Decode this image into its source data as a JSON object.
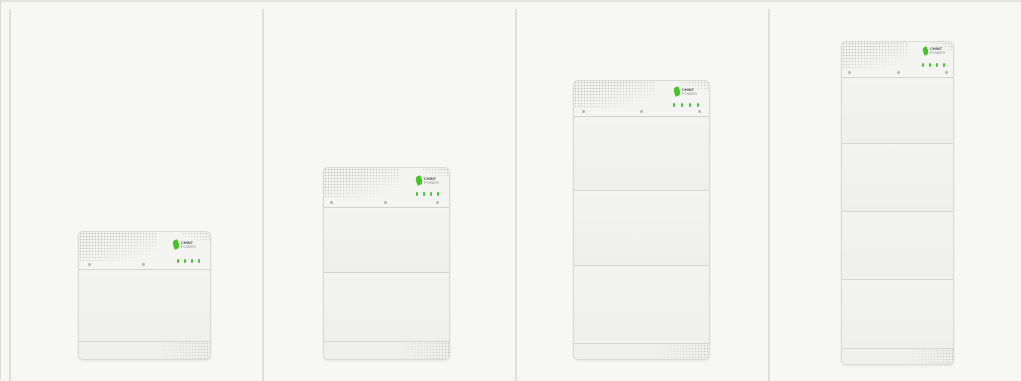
{
  "brand": {
    "line1": "CHINT",
    "line2": "POWER",
    "leaf_color": "#43c61d",
    "led_color": "#49c638"
  },
  "products": [
    {
      "name": "battery-1-module",
      "modules": 1,
      "leds": 4
    },
    {
      "name": "battery-2-modules",
      "modules": 2,
      "leds": 4
    },
    {
      "name": "battery-3-modules",
      "modules": 3,
      "leds": 4
    },
    {
      "name": "battery-4-modules",
      "modules": 4,
      "leds": 4
    }
  ]
}
